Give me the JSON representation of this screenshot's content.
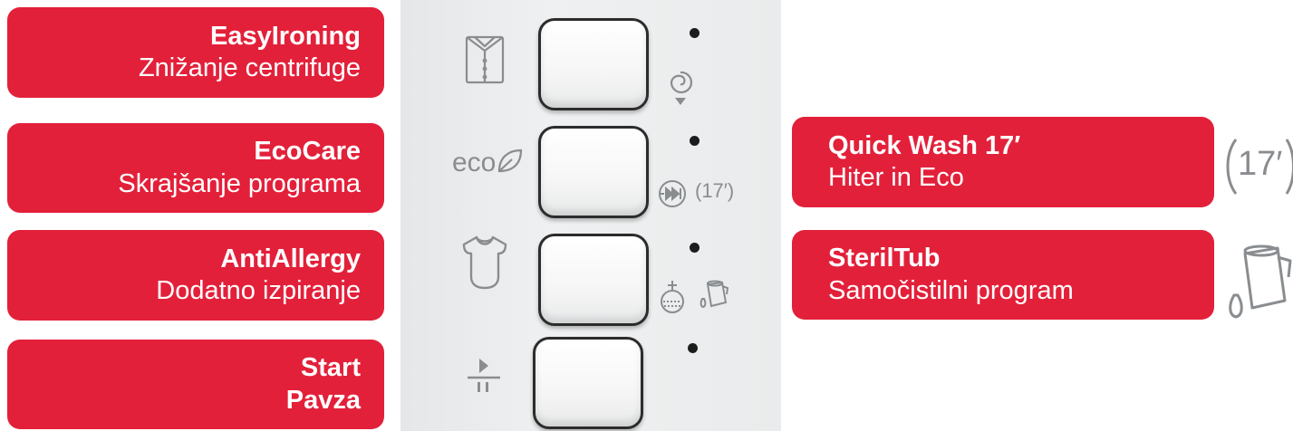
{
  "labels": [
    {
      "title": "EasyIroning",
      "subtitle": "Znižanje centrifuge"
    },
    {
      "title": "EcoCare",
      "subtitle": "Skrajšanje programa"
    },
    {
      "title": "AntiAllergy",
      "subtitle": "Dodatno izpiranje"
    },
    {
      "title": "Start",
      "subtitle": "Pavza"
    },
    {
      "title": "Quick Wash 17′",
      "subtitle": "Hiter in Eco"
    },
    {
      "title": "SterilTub",
      "subtitle": "Samočistilni program"
    }
  ],
  "panel": {
    "eco_text": "eco",
    "timer_small": "(17′)",
    "timer_large": "17′"
  },
  "colors": {
    "accent": "#e3203a",
    "panel": "#eceeef",
    "icon": "#8a8d90"
  },
  "icons": [
    "shirt-icon",
    "spin-reduce-icon",
    "eco-leaf-icon",
    "fast-forward-icon",
    "timer-17-icon",
    "bodysuit-icon",
    "extra-rinse-icon",
    "tub-icon",
    "play-pause-icon",
    "tub-large-icon"
  ]
}
